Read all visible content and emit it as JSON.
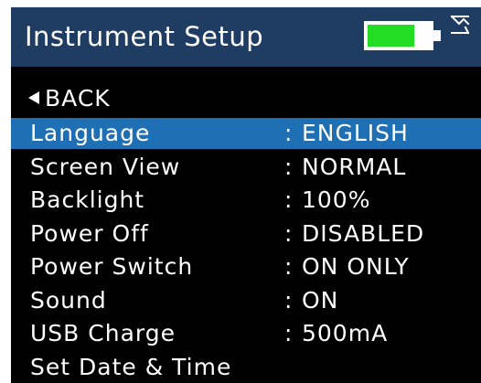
{
  "header": {
    "title": "Instrument Setup",
    "battery_level": 0.75,
    "battery_fill_color": "#22dd22",
    "header_bg": "#1f3d62",
    "status_icon": "usb-charge-icon"
  },
  "nav": {
    "back_label": "BACK",
    "back_icon": "triangle-left-icon"
  },
  "menu": {
    "selected_bg": "#1f6fb5",
    "items": [
      {
        "label": "Language",
        "separator": ":",
        "value": "ENGLISH",
        "selected": true
      },
      {
        "label": "Screen View",
        "separator": ":",
        "value": "NORMAL",
        "selected": false
      },
      {
        "label": "Backlight",
        "separator": ":",
        "value": "100%",
        "selected": false
      },
      {
        "label": "Power Off",
        "separator": ":",
        "value": "DISABLED",
        "selected": false
      },
      {
        "label": "Power Switch",
        "separator": ":",
        "value": "ON ONLY",
        "selected": false
      },
      {
        "label": "Sound",
        "separator": ":",
        "value": "ON",
        "selected": false
      },
      {
        "label": "USB Charge",
        "separator": ":",
        "value": "500mA",
        "selected": false
      },
      {
        "label": "Set Date & Time",
        "separator": "",
        "value": "",
        "selected": false
      }
    ]
  }
}
